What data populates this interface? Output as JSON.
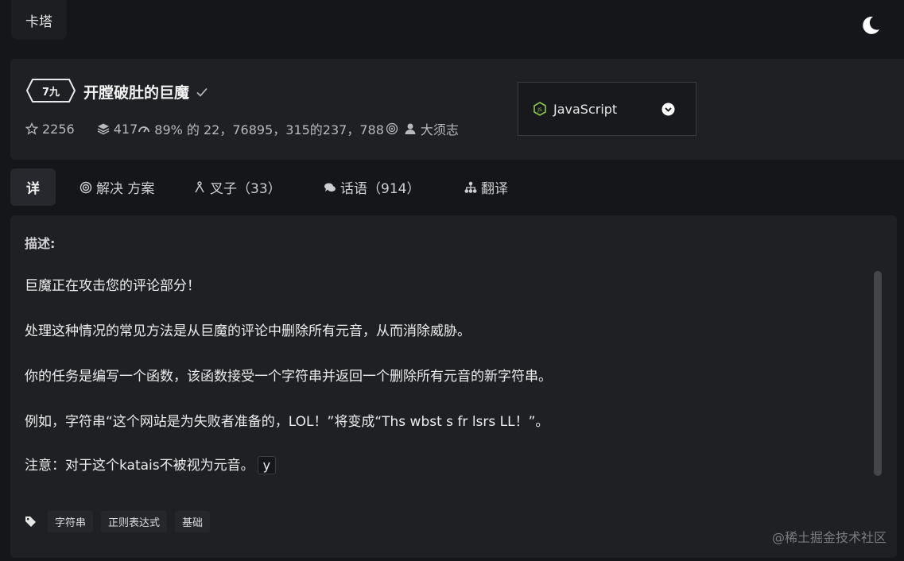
{
  "topbar": {
    "brand": "卡塔"
  },
  "kata": {
    "rank": "7九",
    "title": "开膛破肚的巨魔",
    "stats": {
      "stars": "2256",
      "collections": "417",
      "satisfaction": "89% 的 22，768",
      "completed": "95，315的237，788",
      "author": "大须志"
    }
  },
  "language": {
    "selected": "JavaScript"
  },
  "tabs": [
    {
      "label": "详"
    },
    {
      "label": "解决 方案"
    },
    {
      "label": "叉子（33）"
    },
    {
      "label": "话语（914）"
    },
    {
      "label": "翻译"
    }
  ],
  "description": {
    "label": "描述:",
    "paragraphs": [
      "巨魔正在攻击您的评论部分！",
      "处理这种情况的常见方法是从巨魔的评论中删除所有元音，从而消除威胁。",
      "你的任务是编写一个函数，该函数接受一个字符串并返回一个删除所有元音的新字符串。",
      "例如，字符串“这个网站是为失败者准备的，LOL！”将变成“Ths wbst s fr lsrs LL！”。",
      "注意：对于这个katais不被视为元音。"
    ],
    "code_inline": "y",
    "tags": [
      "字符串",
      "正则表达式",
      "基础"
    ]
  },
  "watermark": "@稀土掘金技术社区",
  "colors": {
    "background": "#151619",
    "card": "#1f2024",
    "js_green": "#8cc84b"
  }
}
